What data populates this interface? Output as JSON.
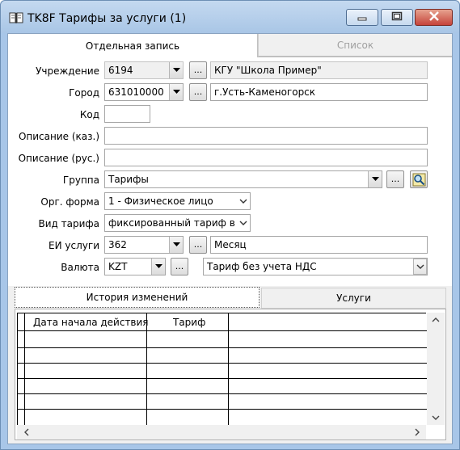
{
  "window": {
    "title": "TK8F Тарифы за услуги (1)",
    "icon": "book-icon",
    "controls": [
      "minimize-icon",
      "maximize-icon",
      "close-icon"
    ]
  },
  "top_tabs": [
    {
      "label": "Отдельная запись",
      "active": true
    },
    {
      "label": "Список",
      "active": false
    }
  ],
  "form": {
    "institution": {
      "label": "Учреждение",
      "code": "6194",
      "name": "КГУ \"Школа Пример\"",
      "browse": "..."
    },
    "city": {
      "label": "Город",
      "code": "631010000",
      "name": "г.Усть-Каменогорск",
      "browse": "..."
    },
    "code": {
      "label": "Код",
      "value": ""
    },
    "desc_kaz": {
      "label": "Описание (каз.)",
      "value": ""
    },
    "desc_rus": {
      "label": "Описание (рус.)",
      "value": ""
    },
    "group": {
      "label": "Группа",
      "value": "Тарифы",
      "browse": "..."
    },
    "org_form": {
      "label": "Орг. форма",
      "value": "1 - Физическое лицо"
    },
    "tariff_type": {
      "label": "Вид тарифа",
      "value": "фиксированный тариф в т"
    },
    "unit": {
      "label": "ЕИ услуги",
      "code": "362",
      "name": "Месяц",
      "browse": "..."
    },
    "currency": {
      "label": "Валюта",
      "code": "KZT",
      "browse": "...",
      "vat": "Тариф без учета НДС"
    }
  },
  "lower_tabs": [
    {
      "label": "История изменений",
      "active": true
    },
    {
      "label": "Услуги",
      "active": false
    }
  ],
  "history_grid": {
    "columns": [
      "Дата начала действия",
      "Тариф",
      ""
    ],
    "rows": [
      [
        "",
        "",
        ""
      ],
      [
        "",
        "",
        ""
      ],
      [
        "",
        "",
        ""
      ],
      [
        "",
        "",
        ""
      ],
      [
        "",
        "",
        ""
      ],
      [
        "",
        "",
        ""
      ]
    ]
  },
  "colors": {
    "titlebar": "#a9c6e6",
    "client": "#f0f0f0",
    "close_button": "#c6443b"
  }
}
